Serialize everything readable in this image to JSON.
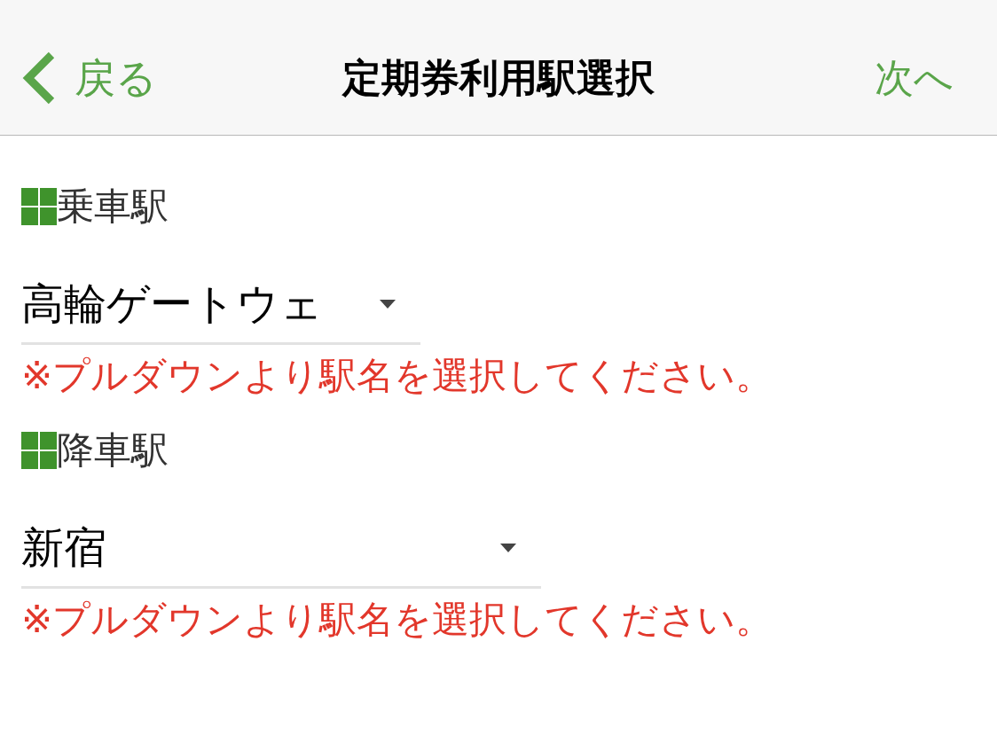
{
  "header": {
    "back": {
      "label": "戻る"
    },
    "title": "定期券利用駅選択",
    "next": {
      "label": "次へ"
    }
  },
  "fields": [
    {
      "label": "乗車駅",
      "value": "高輪ゲートウェ",
      "error": "※プルダウンより駅名を選択してください。"
    },
    {
      "label": "降車駅",
      "value": "新宿",
      "error": "※プルダウンより駅名を選択してください。"
    }
  ]
}
